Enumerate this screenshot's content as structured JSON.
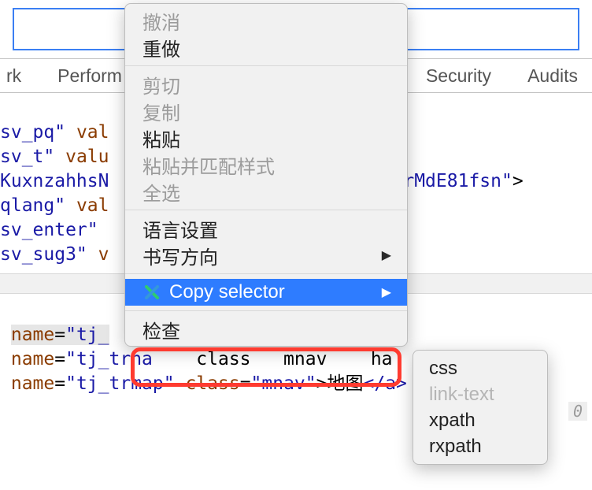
{
  "top_input": {
    "value": ""
  },
  "tabs": {
    "left1": "rk",
    "left2": "Perform",
    "sec": "Security",
    "aud": "Audits"
  },
  "ctx": {
    "undo": "撤消",
    "redo": "重做",
    "cut": "剪切",
    "copy": "复制",
    "paste": "粘贴",
    "paste_match": "粘贴并匹配样式",
    "select_all": "全选",
    "lang": "语言设置",
    "direction": "书写方向",
    "copy_selector": "Copy selector",
    "inspect": "检查"
  },
  "submenu": {
    "css": "css",
    "link_text": "link-text",
    "xpath": "xpath",
    "rxpath": "rxpath"
  },
  "code": {
    "l1_a": "sv_pq\"",
    "l1_b": " val",
    "l2_a": "sv_t\"",
    "l2_b": " valu",
    "l3_a": "KuxnzahhsN",
    "l3_tail": "rMdE81fsn\"",
    "l4_a": "qlang\"",
    "l4_b": " val",
    "l5_a": "sv_enter\"",
    "l6_a": "sv_sug3\"",
    "l6_b": " v",
    "n1_key": "name",
    "n1_val": "\"tj_",
    "n2_key": "name",
    "n2_val": "\"tj_trha",
    "n2_mid": "    class   mnav    ha",
    "n3_key": "name",
    "n3_val": "\"tj_trmap\"",
    "n3_cls_key": " class",
    "n3_cls_val": "\"mnav\"",
    "n3_text": "地图",
    "n3_close": "</a>"
  },
  "side_zero": "0",
  "angle_close": ">"
}
